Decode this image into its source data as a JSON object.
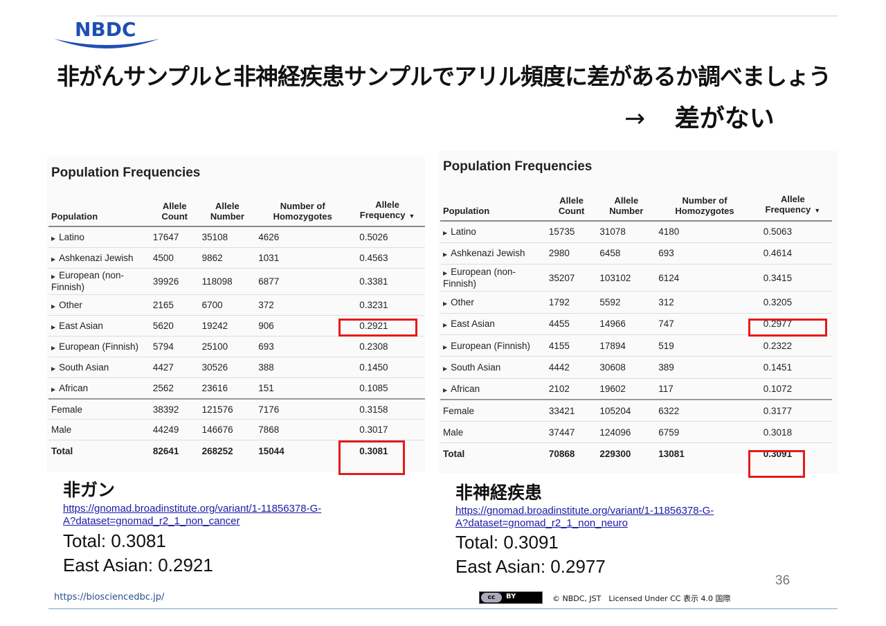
{
  "header": {
    "logo_text": "NBDC"
  },
  "title": "非がんサンプルと非神経疾患サンプルでアリル頻度に差があるか調べましょう",
  "conclusion": {
    "arrow": "→",
    "text": "差がない"
  },
  "colors": {
    "highlight": "#e41a1a",
    "logo_blue": "#1f4fb4",
    "link": "#1a1aa8"
  },
  "left": {
    "panel_title": "Population Frequencies",
    "headers": [
      "Population",
      "Allele Count",
      "Allele Number",
      "Number of Homozygotes",
      "Allele Frequency"
    ],
    "rows": [
      [
        "Latino",
        "17647",
        "35108",
        "4626",
        "0.5026"
      ],
      [
        "Ashkenazi Jewish",
        "4500",
        "9862",
        "1031",
        "0.4563"
      ],
      [
        "European (non-Finnish)",
        "39926",
        "118098",
        "6877",
        "0.3381"
      ],
      [
        "Other",
        "2165",
        "6700",
        "372",
        "0.3231"
      ],
      [
        "East Asian",
        "5620",
        "19242",
        "906",
        "0.2921"
      ],
      [
        "European (Finnish)",
        "5794",
        "25100",
        "693",
        "0.2308"
      ],
      [
        "South Asian",
        "4427",
        "30526",
        "388",
        "0.1450"
      ],
      [
        "African",
        "2562",
        "23616",
        "151",
        "0.1085"
      ],
      [
        "Female",
        "38392",
        "121576",
        "7176",
        "0.3158"
      ],
      [
        "Male",
        "44249",
        "146676",
        "7868",
        "0.3017"
      ],
      [
        "Total",
        "82641",
        "268252",
        "15044",
        "0.3081"
      ]
    ],
    "label": "非ガン",
    "link_line1": "https://gnomad.broadinstitute.org/variant/1-11856378-G-",
    "link_line2": "A?dataset=gnomad_r2_1_non_cancer",
    "total_text": "Total: 0.3081",
    "eastasian_text": "East Asian: 0.2921"
  },
  "right": {
    "panel_title": "Population Frequencies",
    "headers": [
      "Population",
      "Allele Count",
      "Allele Number",
      "Number of Homozygotes",
      "Allele Frequency"
    ],
    "rows": [
      [
        "Latino",
        "15735",
        "31078",
        "4180",
        "0.5063"
      ],
      [
        "Ashkenazi Jewish",
        "2980",
        "6458",
        "693",
        "0.4614"
      ],
      [
        "European (non-Finnish)",
        "35207",
        "103102",
        "6124",
        "0.3415"
      ],
      [
        "Other",
        "1792",
        "5592",
        "312",
        "0.3205"
      ],
      [
        "East Asian",
        "4455",
        "14966",
        "747",
        "0.2977"
      ],
      [
        "European (Finnish)",
        "4155",
        "17894",
        "519",
        "0.2322"
      ],
      [
        "South Asian",
        "4442",
        "30608",
        "389",
        "0.1451"
      ],
      [
        "African",
        "2102",
        "19602",
        "117",
        "0.1072"
      ],
      [
        "Female",
        "33421",
        "105204",
        "6322",
        "0.3177"
      ],
      [
        "Male",
        "37447",
        "124096",
        "6759",
        "0.3018"
      ],
      [
        "Total",
        "70868",
        "229300",
        "13081",
        "0.3091"
      ]
    ],
    "label": "非神経疾患",
    "link_line1": "https://gnomad.broadinstitute.org/variant/1-11856378-G-",
    "link_line2": "A?dataset=gnomad_r2_1_non_neuro",
    "total_text": "Total: 0.3091",
    "eastasian_text": "East Asian: 0.2977"
  },
  "footer": {
    "page_number": "36",
    "url": "https://biosciencedbc.jp/",
    "cc_badge": "BY",
    "copyright": "© NBDC, JST　Licensed Under CC 表示 4.0 国際"
  }
}
